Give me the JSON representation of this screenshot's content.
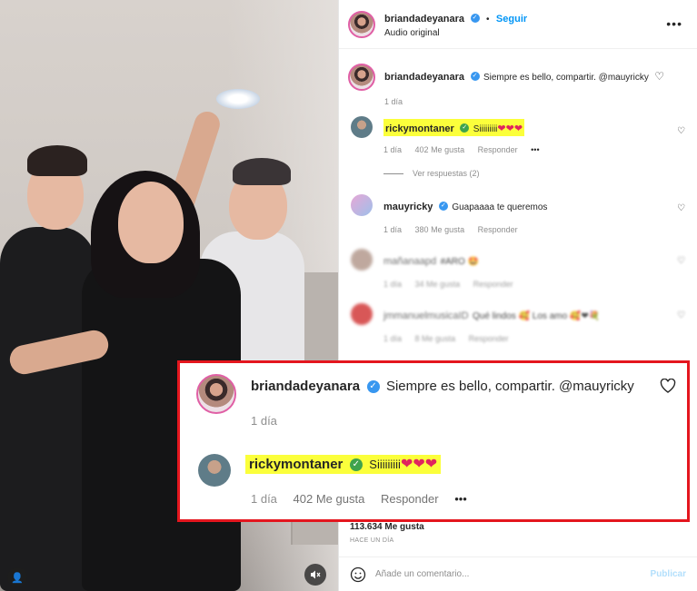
{
  "header": {
    "username": "briandadeyanara",
    "follow_label": "Seguir",
    "separator": "•",
    "audio": "Audio original",
    "more": "•••"
  },
  "caption": {
    "username": "briandadeyanara",
    "text": "Siempre es bello, compartir. @mauyricky",
    "time": "1 día"
  },
  "comments": [
    {
      "username": "rickymontaner",
      "text": "Siiiiiiiii",
      "hearts": "❤❤❤",
      "time": "1 día",
      "likes": "402 Me gusta",
      "reply": "Responder",
      "more": "•••",
      "view_replies": "Ver respuestas (2)"
    },
    {
      "username": "mauyricky",
      "text": "Guapaaaa te queremos",
      "time": "1 día",
      "likes": "380 Me gusta",
      "reply": "Responder"
    },
    {
      "username": "mañanaapd",
      "text": "#ARO 🤩",
      "time": "1 día",
      "likes": "34 Me gusta",
      "reply": "Responder"
    },
    {
      "username": "jmmanuelmusicaID",
      "text": "Qué lindos 🥰 Los amo 🥰❤💐",
      "time": "1 día",
      "likes": "8 Me gusta",
      "reply": "Responder"
    }
  ],
  "stats": {
    "likes": "113.634 Me gusta",
    "date": "HACE UN DÍA"
  },
  "composer": {
    "placeholder": "Añade un comentario...",
    "publish": "Publicar"
  },
  "callout": {
    "caption_username": "briandadeyanara",
    "caption_text": "Siempre es bello, compartir. @mauyricky",
    "caption_time": "1 día",
    "reply_username": "rickymontaner",
    "reply_text": "Siiiiiiiii",
    "reply_hearts": "❤❤❤",
    "reply_time": "1 día",
    "reply_likes": "402 Me gusta",
    "reply_action": "Responder",
    "reply_more": "•••"
  },
  "colors": {
    "highlight": "#fbff3b",
    "callout_border": "#e4161e",
    "link_blue": "#0095f6",
    "heart_red": "#e0245e"
  }
}
